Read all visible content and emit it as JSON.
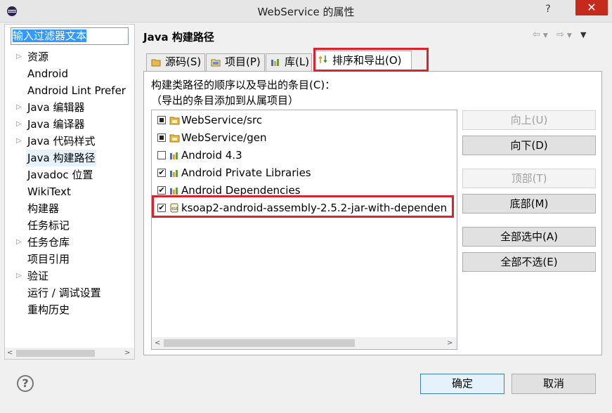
{
  "window": {
    "title": "WebService 的属性",
    "help": "?",
    "close": "✕"
  },
  "filter": {
    "value": "输入过滤器文本"
  },
  "tree": [
    {
      "label": "资源",
      "expandable": true
    },
    {
      "label": "Android",
      "expandable": false
    },
    {
      "label": "Android Lint Prefer",
      "expandable": false
    },
    {
      "label": "Java 编辑器",
      "expandable": true
    },
    {
      "label": "Java 编译器",
      "expandable": true
    },
    {
      "label": "Java 代码样式",
      "expandable": true
    },
    {
      "label": "Java 构建路径",
      "expandable": false,
      "selected": true
    },
    {
      "label": "Javadoc 位置",
      "expandable": false
    },
    {
      "label": "WikiText",
      "expandable": false
    },
    {
      "label": "构建器",
      "expandable": false
    },
    {
      "label": "任务标记",
      "expandable": false
    },
    {
      "label": "任务仓库",
      "expandable": true
    },
    {
      "label": "项目引用",
      "expandable": false
    },
    {
      "label": "验证",
      "expandable": true
    },
    {
      "label": "运行 / 调试设置",
      "expandable": false
    },
    {
      "label": "重构历史",
      "expandable": false
    }
  ],
  "page": {
    "title": "Java 构建路径"
  },
  "tabs": [
    {
      "label": "源码(S)",
      "icon": "source-folder-icon"
    },
    {
      "label": "项目(P)",
      "icon": "project-icon"
    },
    {
      "label": "库(L)",
      "icon": "library-icon"
    },
    {
      "label": "排序和导出(O)",
      "icon": "order-export-icon",
      "active": true
    }
  ],
  "order": {
    "desc1": "构建类路径的顺序以及导出的条目(C)：",
    "desc2": "（导出的条目添加到从属项目）",
    "entries": [
      {
        "label": "WebService/src",
        "check": "partial",
        "icon": "source-folder-icon"
      },
      {
        "label": "WebService/gen",
        "check": "partial",
        "icon": "source-folder-icon"
      },
      {
        "label": "Android 4.3",
        "check": "unchecked",
        "icon": "library-icon"
      },
      {
        "label": "Android Private Libraries",
        "check": "checked",
        "icon": "library-icon"
      },
      {
        "label": "Android Dependencies",
        "check": "checked",
        "icon": "library-icon"
      },
      {
        "label": "ksoap2-android-assembly-2.5.2-jar-with-dependen",
        "check": "checked",
        "icon": "jar-icon"
      }
    ],
    "buttons": {
      "up": "向上(U)",
      "down": "向下(D)",
      "top": "顶部(T)",
      "bottom": "底部(M)",
      "select_all": "全部选中(A)",
      "deselect_all": "全部不选(E)"
    }
  },
  "footer": {
    "ok": "确定",
    "cancel": "取消",
    "help": "?"
  },
  "colors": {
    "highlight_border": "#d9232e",
    "selection": "#3399ff"
  }
}
